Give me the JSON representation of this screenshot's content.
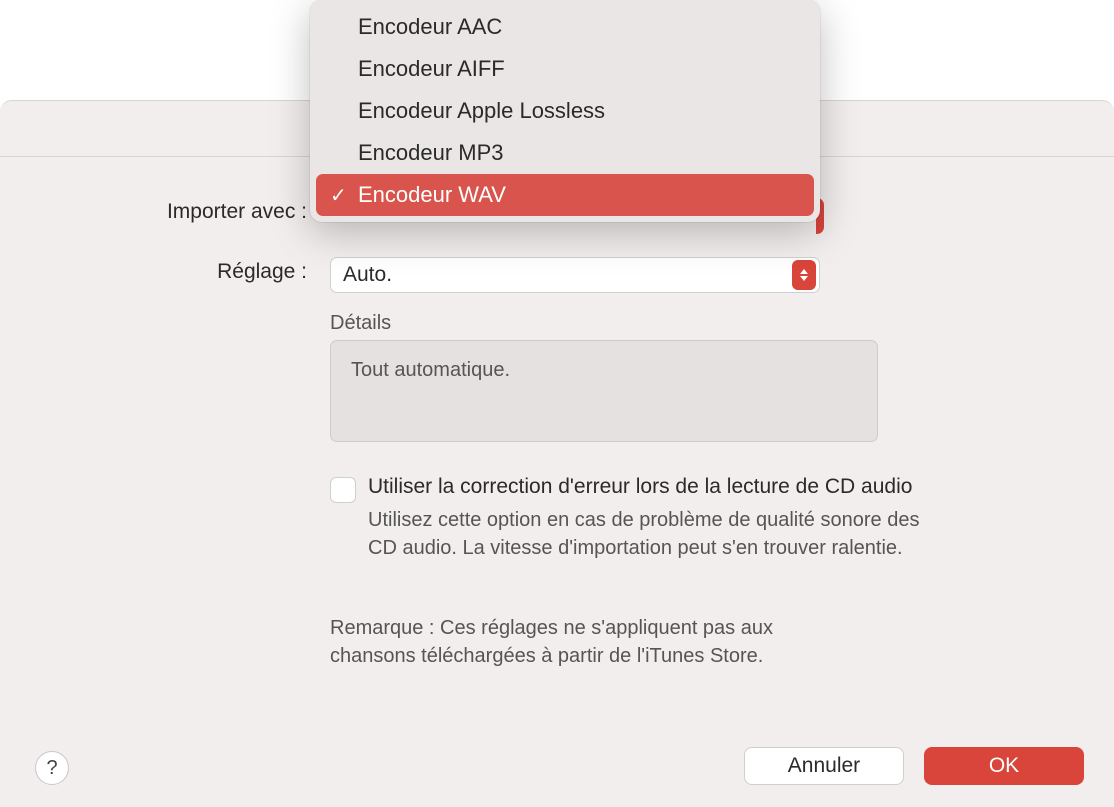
{
  "labels": {
    "import_with": "Importer avec :",
    "setting": "Réglage :",
    "details": "Détails",
    "details_text": "Tout automatique.",
    "checkbox_label": "Utiliser la correction d'erreur lors de la lecture de CD audio",
    "checkbox_help": "Utilisez cette option en cas de problème de qualité sonore des CD audio. La vitesse d'importation peut s'en trouver ralentie.",
    "note": "Remarque : Ces réglages ne s'appliquent pas aux chansons téléchargées à partir de l'iTunes Store."
  },
  "setting_select": {
    "value": "Auto."
  },
  "encoder_menu": {
    "items": [
      {
        "label": "Encodeur AAC",
        "selected": false
      },
      {
        "label": "Encodeur AIFF",
        "selected": false
      },
      {
        "label": "Encodeur Apple Lossless",
        "selected": false
      },
      {
        "label": "Encodeur MP3",
        "selected": false
      },
      {
        "label": "Encodeur WAV",
        "selected": true
      }
    ]
  },
  "buttons": {
    "help": "?",
    "cancel": "Annuler",
    "ok": "OK"
  }
}
